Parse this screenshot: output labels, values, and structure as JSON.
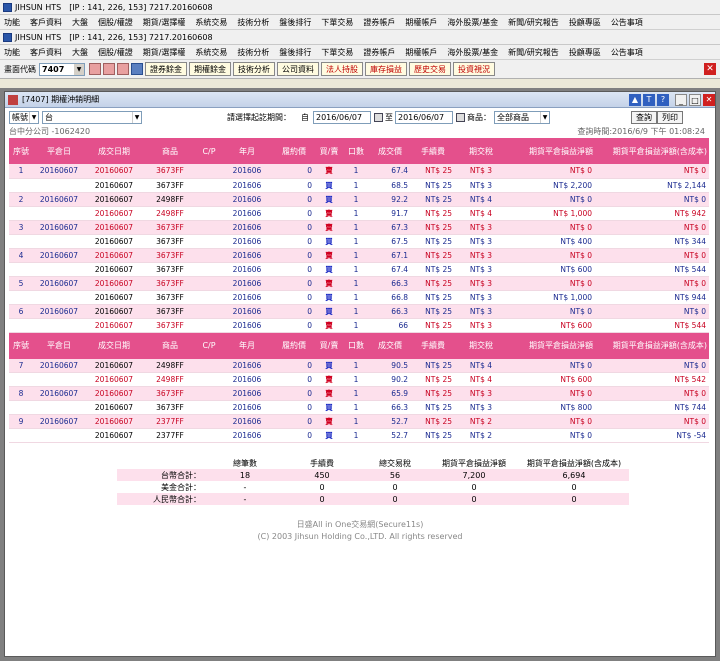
{
  "app": {
    "name": "JIHSUN HTS",
    "ip_info": "[IP : 141, 226, 153] 7217.20160608"
  },
  "menu": [
    "功能",
    "客戶資料",
    "大盤",
    "個股/權證",
    "期貨/選擇權",
    "系統交易",
    "技術分析",
    "盤後排行",
    "下單交易",
    "證券帳戶",
    "期權帳戶",
    "海外股票/基金",
    "新聞/研究報告",
    "投顧專區",
    "公告事項"
  ],
  "toolbar": {
    "code_label": "畫面代碼",
    "code_value": "7407",
    "buttons": [
      "證券餘金",
      "期權餘金",
      "技術分析",
      "公司資料",
      "法人持股",
      "庫存損益",
      "歷史交易",
      "投資視況"
    ]
  },
  "window": {
    "title": "[7407] 期權沖銷明細"
  },
  "filters": {
    "account_type": "帳號",
    "account_value": "台",
    "date_label": "請選擇起訖期間：",
    "from_label": "自",
    "date_from": "2016/06/07",
    "to_label": "至",
    "date_to": "2016/06/07",
    "product_label": "商品：",
    "product_value": "全部商品",
    "query_btn": "查詢",
    "print_btn": "列印"
  },
  "info": {
    "branch": "台中分公司 -1062420",
    "query_time": "查詢時間:2016/6/9 下午 01:08:24"
  },
  "headers": [
    "序號",
    "平倉日",
    "成交日期",
    "商品",
    "C/P",
    "年月",
    "履約價",
    "買/賣",
    "口數",
    "成交價",
    "手續費",
    "期交稅",
    "期貨平倉損益淨額",
    "期貨平倉損益淨額(含成本)"
  ],
  "groups_a": [
    {
      "seq": "1",
      "close_date": "20160607",
      "rows": [
        {
          "date": "20160607",
          "prod": "3673FF",
          "ym": "201606",
          "strike": "0",
          "side": "賣",
          "qty": "1",
          "price": "67.4",
          "fee": "NT$ 25",
          "tax": "NT$ 3",
          "net": "NT$ 0",
          "net2": "NT$ 0"
        },
        {
          "date": "20160607",
          "prod": "3673FF",
          "ym": "201606",
          "strike": "0",
          "side": "買",
          "qty": "1",
          "price": "68.5",
          "fee": "NT$ 25",
          "tax": "NT$ 3",
          "net": "NT$ 2,200",
          "net2": "NT$ 2,144"
        }
      ]
    },
    {
      "seq": "2",
      "close_date": "20160607",
      "rows": [
        {
          "date": "20160607",
          "prod": "2498FF",
          "ym": "201606",
          "strike": "0",
          "side": "買",
          "qty": "1",
          "price": "92.2",
          "fee": "NT$ 25",
          "tax": "NT$ 4",
          "net": "NT$ 0",
          "net2": "NT$ 0"
        },
        {
          "date": "20160607",
          "prod": "2498FF",
          "ym": "201606",
          "strike": "0",
          "side": "賣",
          "qty": "1",
          "price": "91.7",
          "fee": "NT$ 25",
          "tax": "NT$ 4",
          "net": "NT$ 1,000",
          "net2": "NT$ 942"
        }
      ]
    },
    {
      "seq": "3",
      "close_date": "20160607",
      "rows": [
        {
          "date": "20160607",
          "prod": "3673FF",
          "ym": "201606",
          "strike": "0",
          "side": "賣",
          "qty": "1",
          "price": "67.3",
          "fee": "NT$ 25",
          "tax": "NT$ 3",
          "net": "NT$ 0",
          "net2": "NT$ 0"
        },
        {
          "date": "20160607",
          "prod": "3673FF",
          "ym": "201606",
          "strike": "0",
          "side": "買",
          "qty": "1",
          "price": "67.5",
          "fee": "NT$ 25",
          "tax": "NT$ 3",
          "net": "NT$ 400",
          "net2": "NT$ 344"
        }
      ]
    },
    {
      "seq": "4",
      "close_date": "20160607",
      "rows": [
        {
          "date": "20160607",
          "prod": "3673FF",
          "ym": "201606",
          "strike": "0",
          "side": "賣",
          "qty": "1",
          "price": "67.1",
          "fee": "NT$ 25",
          "tax": "NT$ 3",
          "net": "NT$ 0",
          "net2": "NT$ 0"
        },
        {
          "date": "20160607",
          "prod": "3673FF",
          "ym": "201606",
          "strike": "0",
          "side": "買",
          "qty": "1",
          "price": "67.4",
          "fee": "NT$ 25",
          "tax": "NT$ 3",
          "net": "NT$ 600",
          "net2": "NT$ 544"
        }
      ]
    },
    {
      "seq": "5",
      "close_date": "20160607",
      "rows": [
        {
          "date": "20160607",
          "prod": "3673FF",
          "ym": "201606",
          "strike": "0",
          "side": "賣",
          "qty": "1",
          "price": "66.3",
          "fee": "NT$ 25",
          "tax": "NT$ 3",
          "net": "NT$ 0",
          "net2": "NT$ 0"
        },
        {
          "date": "20160607",
          "prod": "3673FF",
          "ym": "201606",
          "strike": "0",
          "side": "買",
          "qty": "1",
          "price": "66.8",
          "fee": "NT$ 25",
          "tax": "NT$ 3",
          "net": "NT$ 1,000",
          "net2": "NT$ 944"
        }
      ]
    },
    {
      "seq": "6",
      "close_date": "20160607",
      "rows": [
        {
          "date": "20160607",
          "prod": "3673FF",
          "ym": "201606",
          "strike": "0",
          "side": "買",
          "qty": "1",
          "price": "66.3",
          "fee": "NT$ 25",
          "tax": "NT$ 3",
          "net": "NT$ 0",
          "net2": "NT$ 0"
        },
        {
          "date": "20160607",
          "prod": "3673FF",
          "ym": "201606",
          "strike": "0",
          "side": "賣",
          "qty": "1",
          "price": "66",
          "fee": "NT$ 25",
          "tax": "NT$ 3",
          "net": "NT$ 600",
          "net2": "NT$ 544"
        }
      ]
    }
  ],
  "groups_b": [
    {
      "seq": "7",
      "close_date": "20160607",
      "rows": [
        {
          "date": "20160607",
          "prod": "2498FF",
          "ym": "201606",
          "strike": "0",
          "side": "買",
          "qty": "1",
          "price": "90.5",
          "fee": "NT$ 25",
          "tax": "NT$ 4",
          "net": "NT$ 0",
          "net2": "NT$ 0"
        },
        {
          "date": "20160607",
          "prod": "2498FF",
          "ym": "201606",
          "strike": "0",
          "side": "賣",
          "qty": "1",
          "price": "90.2",
          "fee": "NT$ 25",
          "tax": "NT$ 4",
          "net": "NT$ 600",
          "net2": "NT$ 542"
        }
      ]
    },
    {
      "seq": "8",
      "close_date": "20160607",
      "rows": [
        {
          "date": "20160607",
          "prod": "3673FF",
          "ym": "201606",
          "strike": "0",
          "side": "賣",
          "qty": "1",
          "price": "65.9",
          "fee": "NT$ 25",
          "tax": "NT$ 3",
          "net": "NT$ 0",
          "net2": "NT$ 0"
        },
        {
          "date": "20160607",
          "prod": "3673FF",
          "ym": "201606",
          "strike": "0",
          "side": "買",
          "qty": "1",
          "price": "66.3",
          "fee": "NT$ 25",
          "tax": "NT$ 3",
          "net": "NT$ 800",
          "net2": "NT$ 744"
        }
      ]
    },
    {
      "seq": "9",
      "close_date": "20160607",
      "rows": [
        {
          "date": "20160607",
          "prod": "2377FF",
          "ym": "201606",
          "strike": "0",
          "side": "賣",
          "qty": "1",
          "price": "52.7",
          "fee": "NT$ 25",
          "tax": "NT$ 2",
          "net": "NT$ 0",
          "net2": "NT$ 0"
        },
        {
          "date": "20160607",
          "prod": "2377FF",
          "ym": "201606",
          "strike": "0",
          "side": "買",
          "qty": "1",
          "price": "52.7",
          "fee": "NT$ 25",
          "tax": "NT$ 2",
          "net": "NT$ 0",
          "net2": "NT$ -54"
        }
      ]
    }
  ],
  "summary": {
    "headers": [
      "總筆數",
      "手續費",
      "總交易稅",
      "期貨平倉損益淨額",
      "期貨平倉損益淨額(含成本)"
    ],
    "rows": [
      {
        "label": "台幣合計：",
        "vals": [
          "18",
          "450",
          "56",
          "7,200",
          "6,694"
        ]
      },
      {
        "label": "美金合計：",
        "vals": [
          "-",
          "0",
          "0",
          "0",
          "0"
        ]
      },
      {
        "label": "人民幣合計：",
        "vals": [
          "-",
          "0",
          "0",
          "0",
          "0"
        ]
      }
    ]
  },
  "footer": {
    "line1": "日盛All in One交易網(Secure11s)",
    "line2": "(C) 2003 Jihsun Holding Co.,LTD. All rights reserved"
  }
}
